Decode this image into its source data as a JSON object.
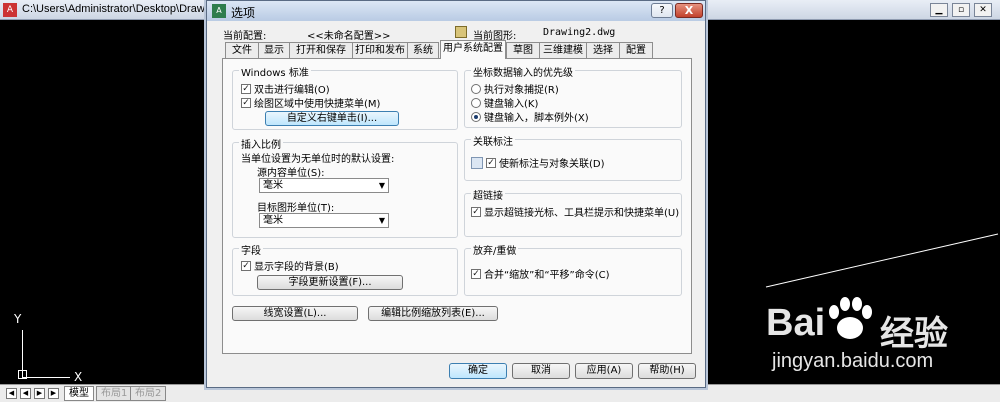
{
  "background_window": {
    "title": "C:\\Users\\Administrator\\Desktop\\Drawing",
    "layout_tabs": [
      "模型",
      "布局1",
      "布局2"
    ],
    "axis_label_y": "Y",
    "axis_label_x": "X"
  },
  "dialog": {
    "title": "选项",
    "help_button": "?",
    "close_button": "X",
    "current_profile_label": "当前配置:",
    "current_profile_value": "<<未命名配置>>",
    "current_drawing_label": "当前图形:",
    "current_drawing_value": "Drawing2.dwg",
    "tabs": [
      "文件",
      "显示",
      "打开和保存",
      "打印和发布",
      "系统",
      "用户系统配置",
      "草图",
      "三维建模",
      "选择",
      "配置"
    ],
    "active_tab": "用户系统配置",
    "windows_group": {
      "title": "Windows 标准",
      "double_click_edit": "双击进行编辑(O)",
      "shortcut_menu": "绘图区域中使用快捷菜单(M)",
      "custom_right_click_button": "自定义右键单击(I)..."
    },
    "insert_scale_group": {
      "title": "插入比例",
      "description": "当单位设置为无单位时的默认设置:",
      "source_label": "源内容单位(S):",
      "source_value": "毫米",
      "target_label": "目标图形单位(T):",
      "target_value": "毫米"
    },
    "fields_group": {
      "title": "字段",
      "show_background": "显示字段的背景(B)",
      "update_settings_button": "字段更新设置(F)..."
    },
    "coord_group": {
      "title": "坐标数据输入的优先级",
      "option1": "执行对象捕捉(R)",
      "option2": "键盘输入(K)",
      "option3": "键盘输入，脚本例外(X)"
    },
    "assoc_group": {
      "title": "关联标注",
      "option": "使新标注与对象关联(D)"
    },
    "hyperlink_group": {
      "title": "超链接",
      "option": "显示超链接光标、工具栏提示和快捷菜单(U)"
    },
    "undo_group": {
      "title": "放弃/重做",
      "option": "合并“缩放”和“平移”命令(C)"
    },
    "lineweight_button": "线宽设置(L)...",
    "scale_list_button": "编辑比例缩放列表(E)...",
    "ok_button": "确定",
    "cancel_button": "取消",
    "apply_button": "应用(A)",
    "help_btn": "帮助(H)"
  },
  "watermark": {
    "brand_left": "Bai",
    "brand_right": "经验",
    "url": "jingyan.baidu.com"
  }
}
